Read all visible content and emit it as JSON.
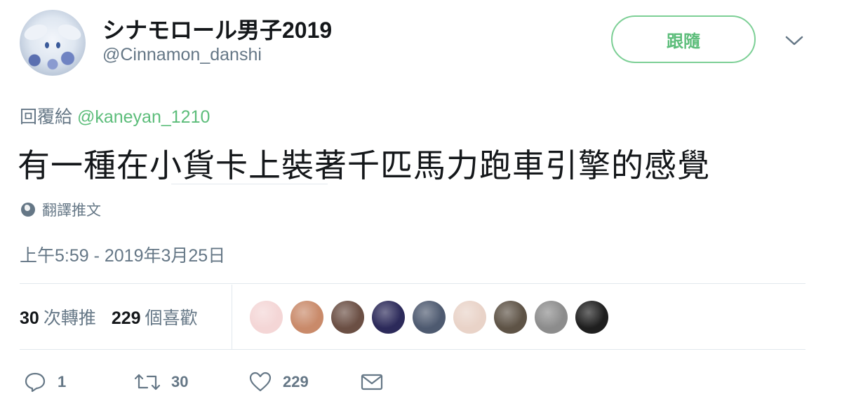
{
  "user": {
    "display_name": "シナモロール男子2019",
    "handle": "@Cinnamon_danshi",
    "avatar_icon": "cinnamoroll-avatar"
  },
  "follow_button": {
    "label": "跟隨",
    "color": "#5cbd7a"
  },
  "menu": {
    "icon": "chevron-down-icon"
  },
  "reply": {
    "prefix": "回覆給",
    "mention": "@kaneyan_1210"
  },
  "tweet": {
    "text": "有一種在小貨卡上裝著千匹馬力跑車引擎的感覺"
  },
  "translate": {
    "label": "翻譯推文",
    "icon": "globe-icon"
  },
  "timestamp": "上午5:59 - 2019年3月25日",
  "stats": {
    "retweets_count": "30",
    "retweets_label": "次轉推",
    "likes_count": "229",
    "likes_label": "個喜歡"
  },
  "likers": [
    {
      "name": "liker-avatar-1",
      "color": "#f4d6d6"
    },
    {
      "name": "liker-avatar-2",
      "color": "#c98a6a"
    },
    {
      "name": "liker-avatar-3",
      "color": "#6b4f44"
    },
    {
      "name": "liker-avatar-4",
      "color": "#2c2a5a"
    },
    {
      "name": "liker-avatar-5",
      "color": "#4e5a70"
    },
    {
      "name": "liker-avatar-6",
      "color": "#e9d3c8"
    },
    {
      "name": "liker-avatar-7",
      "color": "#5e5346"
    },
    {
      "name": "liker-avatar-8",
      "color": "#8c8c8c"
    },
    {
      "name": "liker-avatar-9",
      "color": "#1f1f1f"
    }
  ],
  "actions": {
    "reply_count": "1",
    "retweet_count": "30",
    "like_count": "229"
  },
  "colors": {
    "accent_green": "#5cbd7a",
    "secondary_text": "#657786",
    "primary_text": "#14171a",
    "border": "#e1e8ed"
  }
}
